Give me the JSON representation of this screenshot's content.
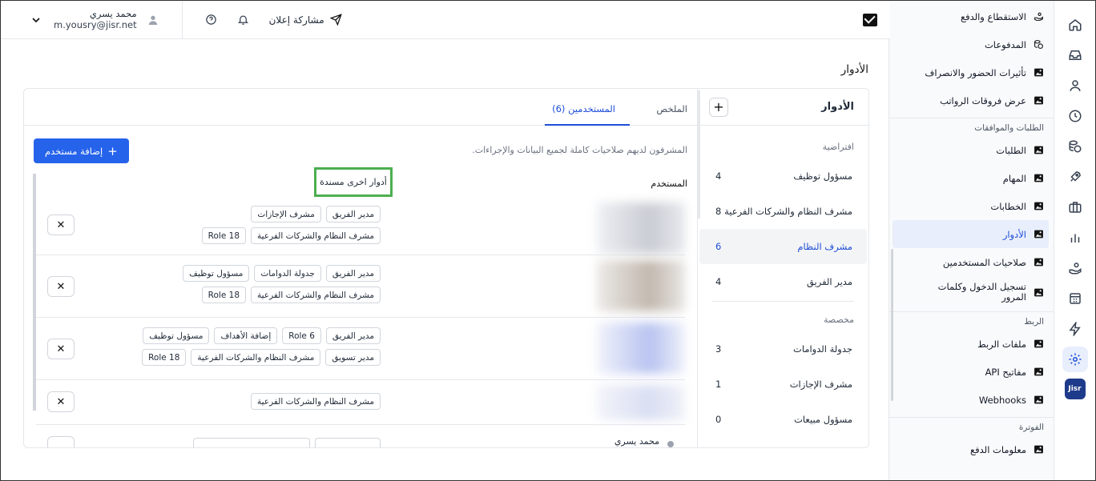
{
  "header": {
    "user_name": "محمد يسري",
    "user_email": "m.yousry@jisr.net",
    "share_label": "مشاركة إعلان"
  },
  "page_title": "الأدوار",
  "sidebar": {
    "items_top": [
      {
        "label": "الاستقطاع والدفع"
      },
      {
        "label": "المدفوعات"
      },
      {
        "label": "تأثيرات الحضور والانصراف"
      },
      {
        "label": "عرض فروقات الرواتب"
      }
    ],
    "section_requests": "الطلبات والموافقات",
    "items_requests": [
      {
        "label": "الطلبات"
      },
      {
        "label": "المهام"
      },
      {
        "label": "الخطابات"
      },
      {
        "label": "الأدوار"
      },
      {
        "label": "صلاحيات المستخدمين"
      },
      {
        "label": "تسجيل الدخول وكلمات المرور"
      }
    ],
    "section_integration": "الربط",
    "items_integration": [
      {
        "label": "ملفات الربط"
      },
      {
        "label": "مفاتيح API"
      },
      {
        "label": "Webhooks"
      }
    ],
    "section_billing": "الفوترة",
    "items_billing": [
      {
        "label": "معلومات الدفع"
      }
    ]
  },
  "rail_logo": "Jisr",
  "roles_panel": {
    "title": "الأدوار",
    "default_group": "افتراضية",
    "custom_group": "مخصصة",
    "default_roles": [
      {
        "name": "مسؤول توظيف",
        "count": "4"
      },
      {
        "name": "مشرف النظام والشركات الفرعية",
        "count": "8"
      },
      {
        "name": "مشرف النظام",
        "count": "6"
      },
      {
        "name": "مدير الفريق",
        "count": "4"
      }
    ],
    "custom_roles": [
      {
        "name": "جدولة الدوامات",
        "count": "3"
      },
      {
        "name": "مشرف الإجازات",
        "count": "1"
      },
      {
        "name": "مسؤول مبيعات",
        "count": "0"
      }
    ]
  },
  "content": {
    "tab_summary": "الملخص",
    "tab_users": "المستخدمين (6)",
    "description": "المشرفون لديهم صلاحيات كاملة لجميع البيانات والإجراءات.",
    "add_user": "إضافة مستخدم",
    "col_user": "المستخدم",
    "col_other_roles": "أدوار اخرى مسندة",
    "last_user_name": "محمد يسري"
  },
  "user_rows": [
    {
      "tags": [
        "مدير الفريق",
        "مشرف الإجازات",
        "مشرف النظام والشركات الفرعية",
        "Role 18"
      ]
    },
    {
      "tags": [
        "مدير الفريق",
        "جدولة الدوامات",
        "مسؤول توظيف",
        "مشرف النظام والشركات الفرعية",
        "Role 18"
      ]
    },
    {
      "tags": [
        "مدير الفريق",
        "Role 6",
        "إضافة الأهداف",
        "مسؤول توظيف",
        "مدير تسويق",
        "مشرف النظام والشركات الفرعية",
        "Role 18"
      ]
    },
    {
      "tags": [
        "مشرف النظام والشركات الفرعية"
      ]
    }
  ],
  "colors": {
    "accent": "#2563eb",
    "highlight_border": "#4caf50"
  }
}
